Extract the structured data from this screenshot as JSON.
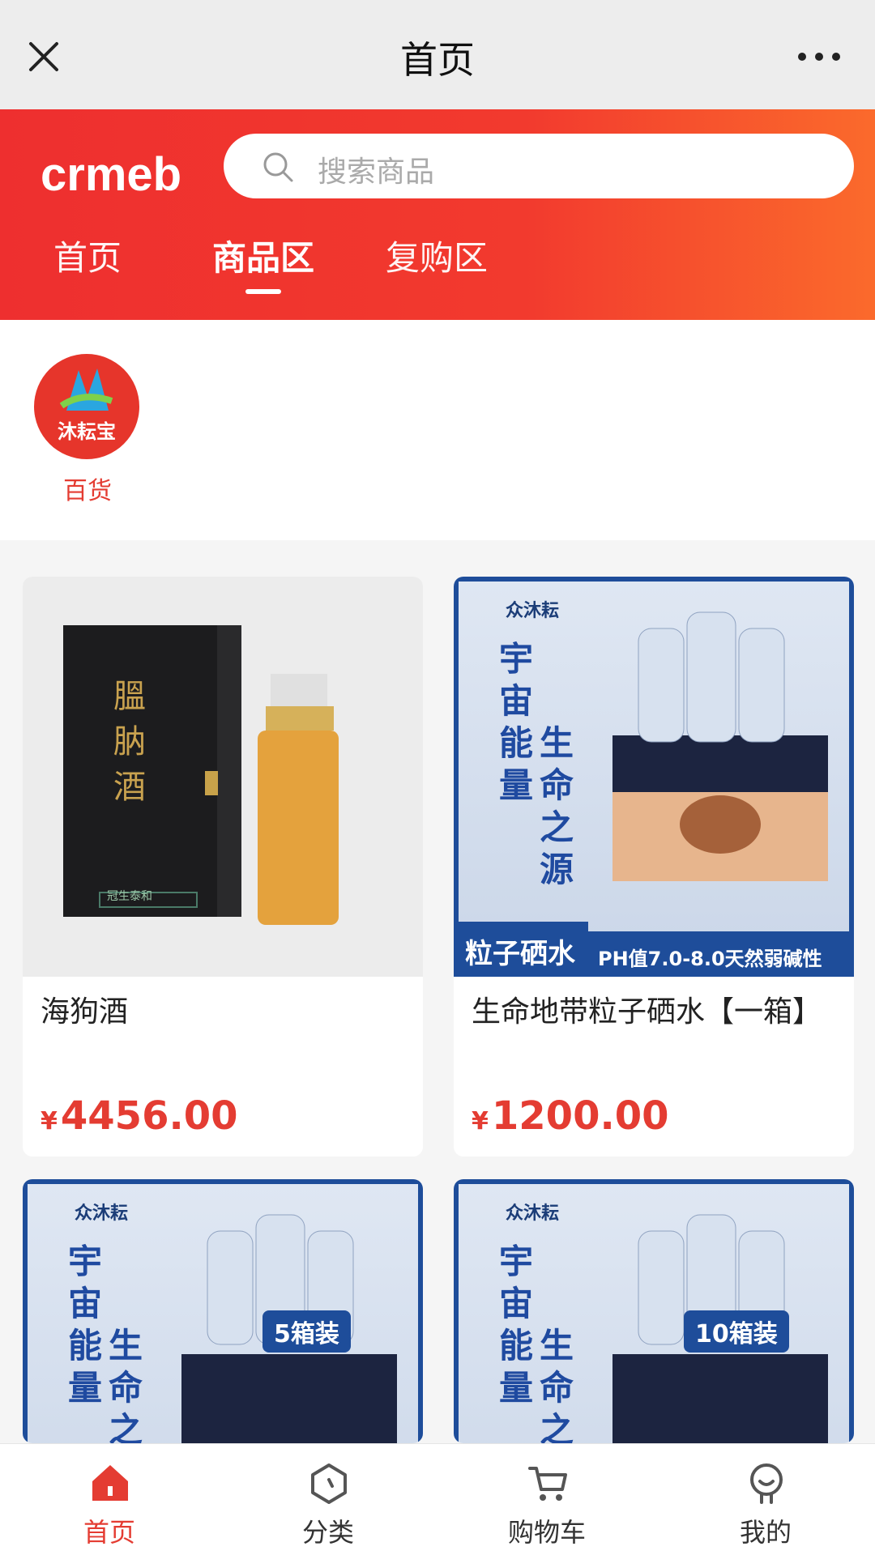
{
  "topbar": {
    "title": "首页"
  },
  "header": {
    "logo_text": "crmeb",
    "search_placeholder": "搜索商品",
    "tabs": [
      {
        "label": "首页"
      },
      {
        "label": "商品区"
      },
      {
        "label": "复购区"
      }
    ],
    "active_tab": "商品区"
  },
  "categories": [
    {
      "label": "百货",
      "brand_text": "沐耘宝"
    }
  ],
  "products": [
    {
      "name": "海狗酒",
      "price_symbol": "¥",
      "price": "4456.00",
      "image_box_text": "膃肭酒",
      "image_box_sub": "冠生泰和"
    },
    {
      "name": "生命地带粒子硒水【一箱】",
      "price_symbol": "¥",
      "price": "1200.00",
      "image_brand": "众沐耘",
      "image_slogan_a": "宇宙能量",
      "image_slogan_b": "生命之源",
      "ribbon_left": "粒子硒水",
      "ribbon_right": "PH值7.0-8.0天然弱碱性"
    },
    {
      "name": "",
      "image_brand": "众沐耘",
      "image_slogan_a": "宇宙能量",
      "image_slogan_b": "生命之",
      "badge": "5箱装"
    },
    {
      "name": "",
      "image_brand": "众沐耘",
      "image_slogan_a": "宇宙能量",
      "image_slogan_b": "生命之",
      "badge": "10箱装"
    }
  ],
  "bottom_nav": [
    {
      "label": "首页",
      "icon": "home-icon",
      "active": true
    },
    {
      "label": "分类",
      "icon": "category-icon",
      "active": false
    },
    {
      "label": "购物车",
      "icon": "cart-icon",
      "active": false
    },
    {
      "label": "我的",
      "icon": "profile-icon",
      "active": false
    }
  ],
  "colors": {
    "accent": "#e43c32",
    "header_start": "#ee2f2f",
    "header_end": "#fb6a2c",
    "water_blue": "#1e4d9a"
  }
}
